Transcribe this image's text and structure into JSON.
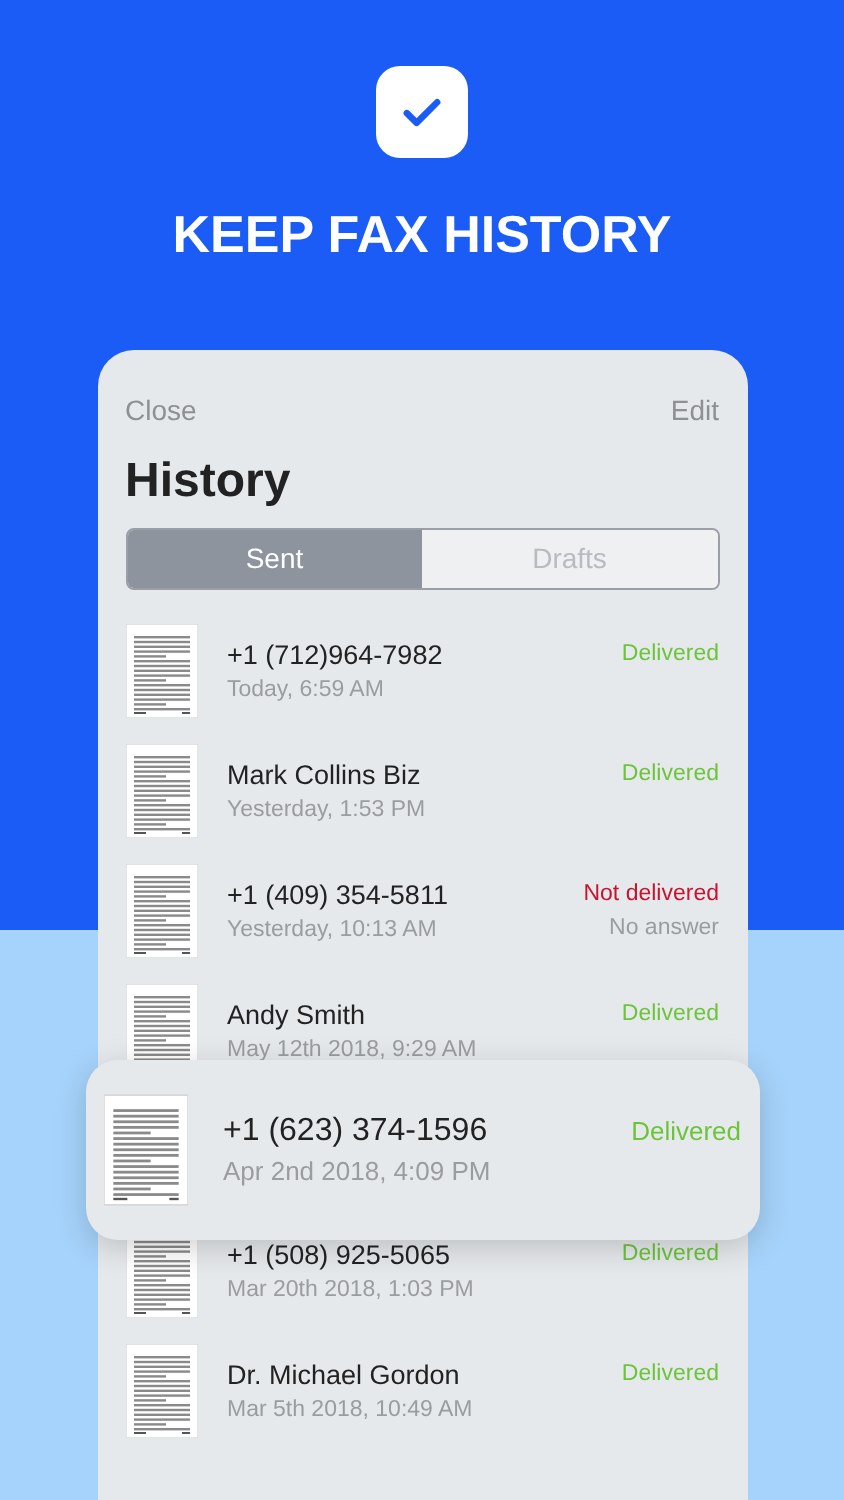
{
  "title": "KEEP FAX HISTORY",
  "panel": {
    "close": "Close",
    "edit": "Edit",
    "title": "History"
  },
  "tabs": [
    {
      "label": "Sent",
      "selected": true
    },
    {
      "label": "Drafts",
      "selected": false
    }
  ],
  "rows": [
    {
      "name": "+1 (712)964-7982",
      "time": "Today, 6:59 AM",
      "status": "Delivered",
      "delivered": true,
      "selected": false
    },
    {
      "name": "Mark Collins Biz",
      "time": "Yesterday, 1:53 PM",
      "status": "Delivered",
      "delivered": true,
      "selected": false
    },
    {
      "name": "+1 (409) 354-5811",
      "time": "Yesterday, 10:13 AM",
      "status": "Not delivered",
      "delivered": false,
      "reason": "No answer",
      "selected": false
    },
    {
      "name": "Andy Smith",
      "time": "May 12th 2018, 9:29 AM",
      "status": "Delivered",
      "delivered": true,
      "selected": false
    },
    {
      "name": "+1 (623) 374-1596",
      "time": "Apr 2nd 2018, 4:09 PM",
      "status": "Delivered",
      "delivered": true,
      "selected": true
    },
    {
      "name": "+1 (508) 925-5065",
      "time": "Mar 20th 2018, 1:03 PM",
      "status": "Delivered",
      "delivered": true,
      "selected": false
    },
    {
      "name": "Dr. Michael Gordon",
      "time": "Mar 5th 2018, 10:49 AM",
      "status": "Delivered",
      "delivered": true,
      "selected": false
    }
  ]
}
